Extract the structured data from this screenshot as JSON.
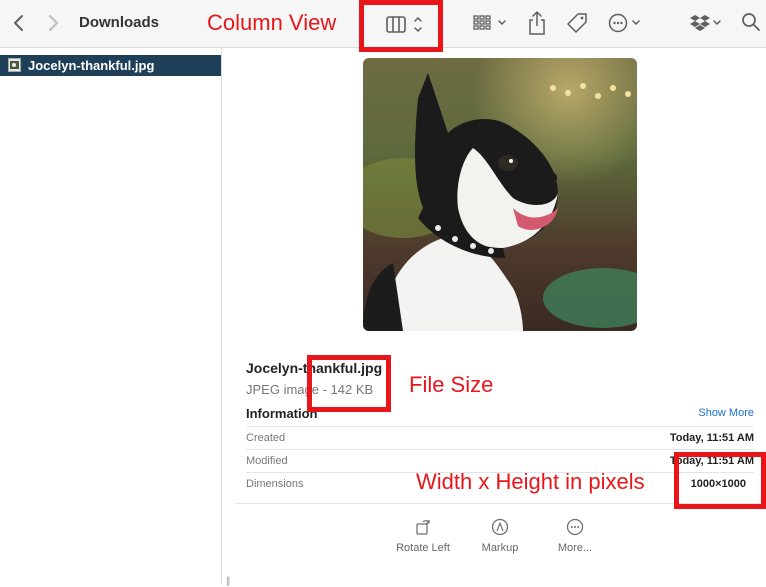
{
  "toolbar": {
    "title": "Downloads"
  },
  "sidebar": {
    "selected_file": "Jocelyn-thankful.jpg"
  },
  "preview": {
    "file_name": "Jocelyn-thankful.jpg",
    "file_meta": "JPEG image - 142 KB",
    "info_heading": "Information",
    "show_more": "Show More",
    "rows": [
      {
        "label": "Created",
        "value": "Today, 11:51 AM"
      },
      {
        "label": "Modified",
        "value": "Today, 11:51 AM"
      },
      {
        "label": "Dimensions",
        "value": "1000×1000"
      }
    ],
    "actions": [
      {
        "label": "Rotate Left",
        "icon": "rotate-left-icon"
      },
      {
        "label": "Markup",
        "icon": "markup-icon"
      },
      {
        "label": "More...",
        "icon": "more-icon"
      }
    ]
  },
  "annotations": {
    "column_view": "Column View",
    "file_size": "File Size",
    "dimensions": "Width x Height in pixels",
    "color": "#e8161b"
  }
}
